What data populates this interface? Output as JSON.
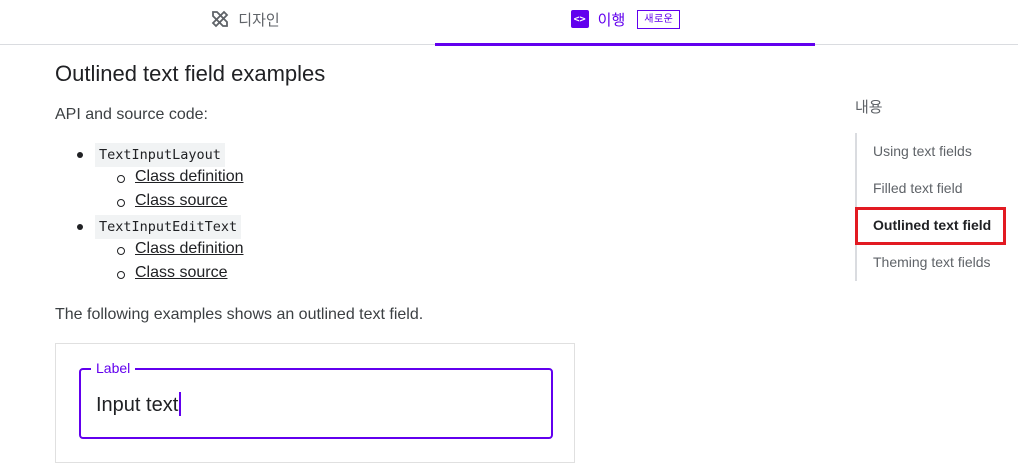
{
  "tabs": {
    "design": {
      "label": "디자인",
      "icon": "design-tools-icon"
    },
    "implementation": {
      "label": "이행",
      "icon": "code-icon",
      "icon_glyph": "<>",
      "badge": "새로운"
    }
  },
  "main": {
    "title": "Outlined text field examples",
    "api_intro": "API and source code:",
    "api_groups": [
      {
        "code": "TextInputLayout",
        "links": [
          "Class definition",
          "Class source"
        ]
      },
      {
        "code": "TextInputEditText",
        "links": [
          "Class definition",
          "Class source"
        ]
      }
    ],
    "following": "The following examples shows an outlined text field.",
    "example": {
      "label": "Label",
      "value": "Input text"
    }
  },
  "toc": {
    "title": "내용",
    "items": [
      "Using text fields",
      "Filled text field",
      "Outlined text field",
      "Theming text fields"
    ],
    "active_index": 2
  },
  "colors": {
    "accent": "#6200ee",
    "highlight": "#e21a22"
  }
}
